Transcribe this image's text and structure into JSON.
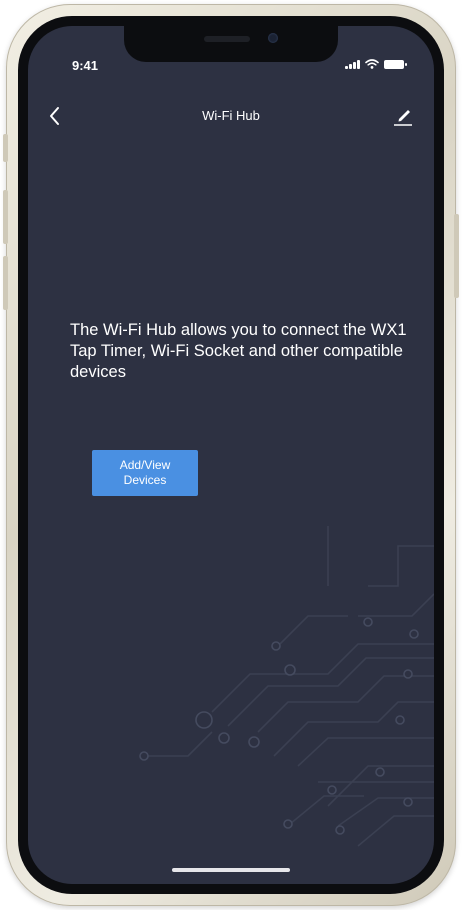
{
  "status_bar": {
    "time": "9:41",
    "icons": [
      "signal-icon",
      "wifi-icon",
      "battery-icon"
    ]
  },
  "nav": {
    "title": "Wi-Fi Hub",
    "back_icon": "chevron-left-icon",
    "edit_icon": "pencil-icon"
  },
  "content": {
    "description": "The Wi-Fi Hub allows you to connect the WX1 Tap Timer, Wi-Fi Socket and other compatible devices",
    "add_view_button_label": "Add/View Devices"
  },
  "colors": {
    "screen_background": "#2d3142",
    "button_background": "#4a90e2",
    "text": "#ffffff",
    "device_frame": "#e8e4d6"
  }
}
